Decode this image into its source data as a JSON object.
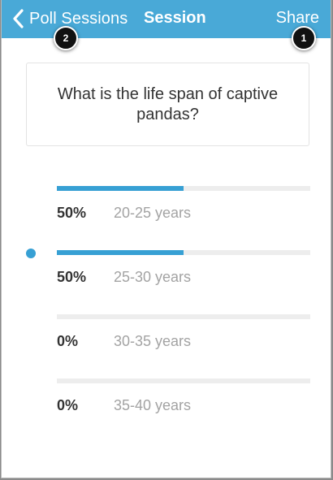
{
  "navbar": {
    "back_label": "Poll Sessions",
    "title": "Session",
    "share_label": "Share",
    "background": "#49a9d7"
  },
  "badges": [
    "2",
    "1"
  ],
  "question": "What is the life span of captive pandas?",
  "answers": [
    {
      "percent_label": "50%",
      "label": "20-25 years",
      "fraction": 0.5,
      "selected": false
    },
    {
      "percent_label": "50%",
      "label": "25-30 years",
      "fraction": 0.5,
      "selected": true
    },
    {
      "percent_label": "0%",
      "label": "30-35 years",
      "fraction": 0.0,
      "selected": false
    },
    {
      "percent_label": "0%",
      "label": "35-40 years",
      "fraction": 0.0,
      "selected": false
    }
  ],
  "colors": {
    "accent": "#37a0d4",
    "track": "#ededed"
  }
}
